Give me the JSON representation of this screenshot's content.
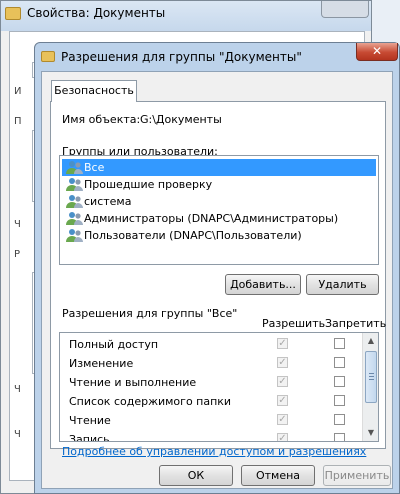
{
  "back_window": {
    "title": "Свойства: Документы",
    "side_marks": [
      "И",
      "П",
      "Ч",
      "Р",
      "Ч",
      "Ч"
    ]
  },
  "dialog": {
    "title": "Разрешения для группы \"Документы\"",
    "close_glyph": "✕",
    "tab_label": "Безопасность",
    "object_name_label": "Имя объекта:",
    "object_name_value": "G:\\Документы",
    "groups_label": "Группы или пользователи:",
    "groups": [
      {
        "label": "Все",
        "selected": true
      },
      {
        "label": "Прошедшие проверку",
        "selected": false
      },
      {
        "label": "система",
        "selected": false
      },
      {
        "label": "Администраторы (DNAPC\\Администраторы)",
        "selected": false
      },
      {
        "label": "Пользователи (DNAPC\\Пользователи)",
        "selected": false
      }
    ],
    "add_button": "Добавить...",
    "remove_button": "Удалить",
    "permissions_label": "Разрешения для группы \"Все\"",
    "allow_header": "Разрешить",
    "deny_header": "Запретить",
    "permissions": [
      {
        "name": "Полный доступ",
        "allow": true,
        "deny": false
      },
      {
        "name": "Изменение",
        "allow": true,
        "deny": false
      },
      {
        "name": "Чтение и выполнение",
        "allow": true,
        "deny": false
      },
      {
        "name": "Список содержимого папки",
        "allow": true,
        "deny": false
      },
      {
        "name": "Чтение",
        "allow": true,
        "deny": false
      },
      {
        "name": "Запись",
        "allow": true,
        "deny": false
      }
    ],
    "check_glyph": "✓",
    "help_link": "Подробнее об управлении доступом и разрешениях",
    "ok_button": "ОК",
    "cancel_button": "Отмена",
    "apply_button": "Применить"
  },
  "colors": {
    "selection": "#3399ff",
    "link": "#0066cc",
    "close_button": "#c74a33"
  }
}
